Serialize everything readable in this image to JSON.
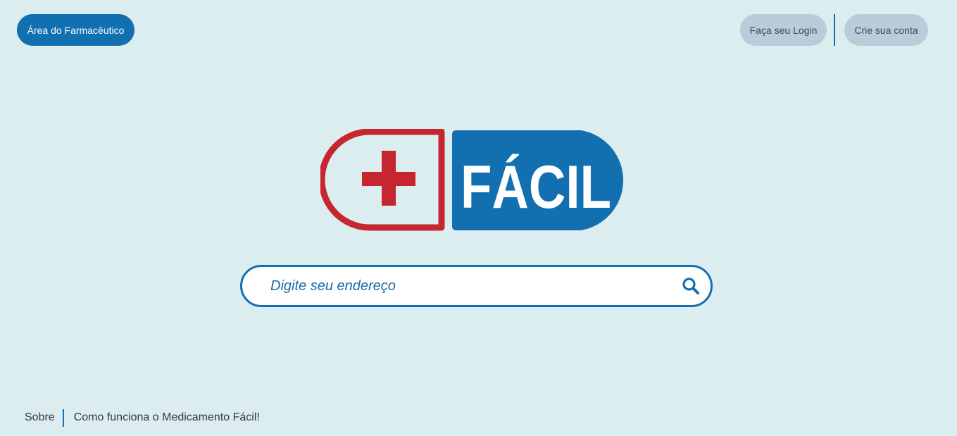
{
  "header": {
    "pharmacist_area_label": "Área do Farmacêutico",
    "login_label": "Faça seu Login",
    "signup_label": "Crie sua conta"
  },
  "logo": {
    "word": "FÁCIL",
    "icon": "plus-icon"
  },
  "search": {
    "placeholder": "Digite seu endereço",
    "value": "",
    "icon": "search-icon"
  },
  "footer": {
    "about_label": "Sobre",
    "how_it_works_label": "Como funciona o Medicamento Fácil!"
  },
  "colors": {
    "background": "#dcedf0",
    "primary_blue": "#1270b1",
    "brand_red": "#c52630",
    "secondary_button": "#b8cdd9"
  }
}
